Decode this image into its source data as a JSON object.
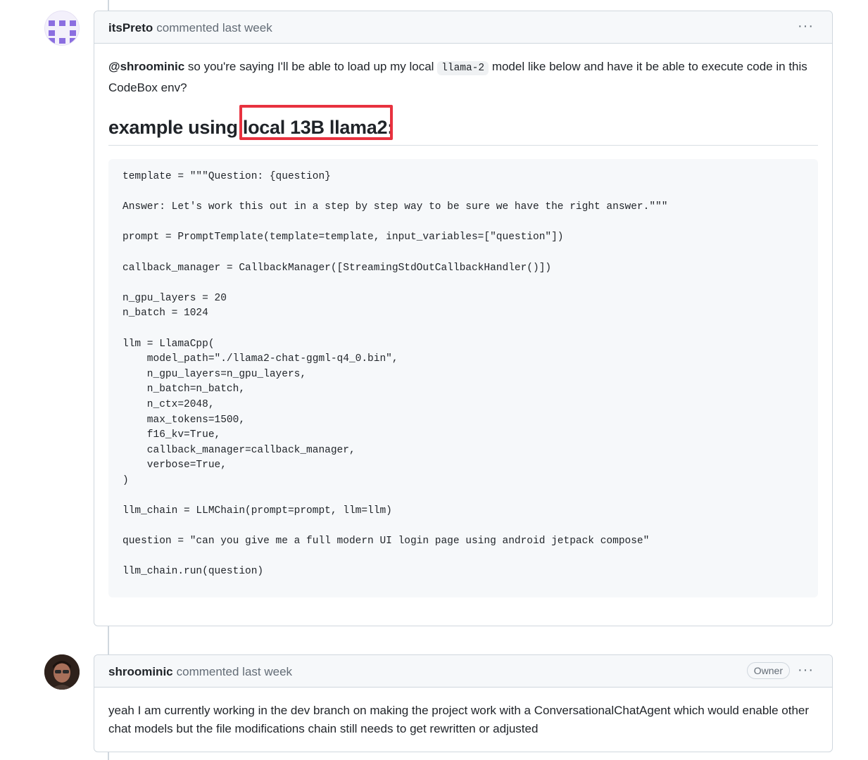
{
  "comment1": {
    "author": "itsPreto",
    "meta": "commented last week",
    "menu": "···",
    "mention": "@shroominic",
    "text_before_code": " so you're saying I'll be able to load up my local ",
    "inline_code": "llama-2",
    "text_after_code": " model like below and have it be able to execute code in this CodeBox env?",
    "heading": "example using local 13B llama2:",
    "highlighted_text": "local 13B llama2:",
    "code": "template = \"\"\"Question: {question}\n\nAnswer: Let's work this out in a step by step way to be sure we have the right answer.\"\"\"\n\nprompt = PromptTemplate(template=template, input_variables=[\"question\"])\n\ncallback_manager = CallbackManager([StreamingStdOutCallbackHandler()])\n\nn_gpu_layers = 20\nn_batch = 1024\n\nllm = LlamaCpp(\n    model_path=\"./llama2-chat-ggml-q4_0.bin\",\n    n_gpu_layers=n_gpu_layers,\n    n_batch=n_batch,\n    n_ctx=2048,\n    max_tokens=1500,\n    f16_kv=True,\n    callback_manager=callback_manager,\n    verbose=True,\n)\n\nllm_chain = LLMChain(prompt=prompt, llm=llm)\n\nquestion = \"can you give me a full modern UI login page using android jetpack compose\"\n\nllm_chain.run(question)"
  },
  "comment2": {
    "author": "shroominic",
    "meta": "commented last week",
    "badge": "Owner",
    "menu": "···",
    "text": "yeah I am currently working in the dev branch on making the project work with a ConversationalChatAgent which would enable other chat models but the file modifications chain still needs to get rewritten or adjusted"
  },
  "colors": {
    "highlight_border": "#e8323f",
    "avatar_identicon": "#8b6ee0"
  }
}
